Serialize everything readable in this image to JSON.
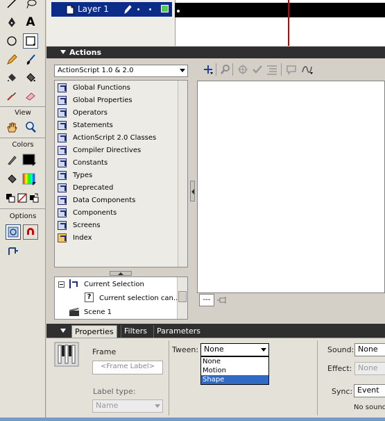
{
  "tools_panel": {
    "view_label": "View",
    "colors_label": "Colors",
    "options_label": "Options",
    "text_tool_glyph": "A",
    "colors": {
      "stroke": "#000000",
      "fill": "#000000"
    }
  },
  "timeline": {
    "layer_name": "Layer 1"
  },
  "actions_panel": {
    "title": "Actions",
    "version_select": "ActionScript 1.0 & 2.0",
    "toolbox_items": [
      "Global Functions",
      "Global Properties",
      "Operators",
      "Statements",
      "ActionScript 2.0 Classes",
      "Compiler Directives",
      "Constants",
      "Types",
      "Deprecated",
      "Data Components",
      "Components",
      "Screens",
      "Index"
    ],
    "tree": {
      "current_selection": "Current Selection",
      "current_selection_child": "Current selection can...",
      "scene": "Scene 1"
    },
    "script_tab_label": "---"
  },
  "properties_panel": {
    "tabs": [
      "Properties",
      "Filters",
      "Parameters"
    ],
    "frame_label": "Frame",
    "frame_label_placeholder": "<Frame Label>",
    "label_type_label": "Label type:",
    "label_type_value": "Name",
    "tween_label": "Tween:",
    "tween_value": "None",
    "tween_options": [
      "None",
      "Motion",
      "Shape"
    ],
    "tween_highlighted": "Shape",
    "sound_label": "Sound:",
    "sound_value": "None",
    "effect_label": "Effect:",
    "effect_value": "None",
    "sync_label": "Sync:",
    "sync_value": "Event",
    "no_sound": "No sound"
  }
}
